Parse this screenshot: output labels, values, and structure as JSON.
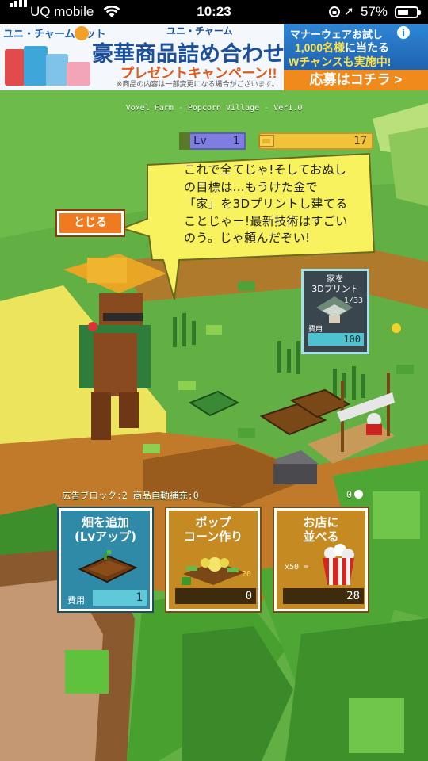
{
  "status_bar": {
    "carrier": "UQ mobile",
    "time": "10:23",
    "battery": "57%",
    "battery_level": 0.57
  },
  "ad": {
    "brand": "ユニ・チャームペット",
    "sub_brand": "ユニ・チャーム",
    "headline": "豪華商品詰め合わせ",
    "campaign": "プレゼントキャンペーン!!",
    "note": "※商品の内容は一部変更になる場合がございます。",
    "right_line1": "マナーウェアお試し",
    "right_line2_prefix": "1,000名様",
    "right_line2_suffix": "に当たる",
    "right_line3": "Wチャンスも実施中!",
    "cta": "応募はコチラ >",
    "info_icon": "i",
    "close_icon": "✕"
  },
  "game": {
    "title": "Voxel Farm - Popcorn Village - Ver1.0",
    "level_label": "Lv",
    "level": "1",
    "gold": "17",
    "dialog": "これで全てじゃ!そしておぬし\nの目標は...もうけた金で\n「家」を3Dプリントし建てる\nことじゃー!最新技術はすごい\nのう。じゃ頼んだぞい!",
    "close_button": "とじる",
    "print_card": {
      "name": "家を\n3Dプリント",
      "progress": "1/33",
      "cost_label": "費用",
      "cost": "100"
    },
    "info_line": "広告ブロック:2 商品自動補充:0",
    "coin_count": "0",
    "cards": {
      "field": {
        "title": "畑を追加\n(Lvアップ)",
        "cost_label": "費用",
        "cost": "1"
      },
      "popcorn": {
        "title": "ポップ\nコーン作り",
        "small": "20",
        "cost": "0"
      },
      "shop": {
        "title": "お店に\n並べる",
        "mult": "x50 =",
        "cost": "28"
      }
    }
  },
  "colors": {
    "grass": "#5fae43",
    "dirt": "#c07a2a",
    "sand": "#e9e25a",
    "bubble": "#f7f25e",
    "accent_orange": "#ef7a1f",
    "teal": "#2f8aa8"
  }
}
